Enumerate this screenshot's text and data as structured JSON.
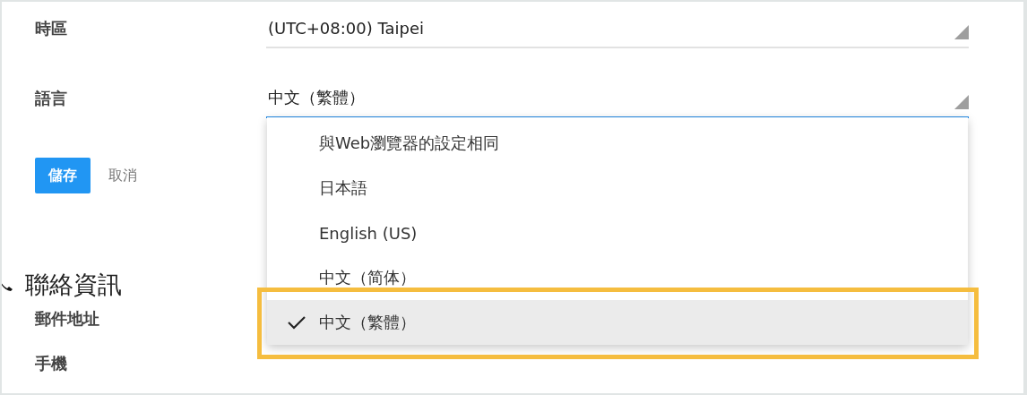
{
  "settings": [
    {
      "label": "時區",
      "value": "(UTC+08:00) Taipei",
      "focused": false
    },
    {
      "label": "語言",
      "value": "中文（繁體）",
      "focused": true
    }
  ],
  "buttons": [
    {
      "label": "儲存",
      "kind": "primary"
    },
    {
      "label": "取消",
      "kind": "text"
    }
  ],
  "section": {
    "title": "聯絡資訊"
  },
  "contact_fields": [
    {
      "label": "郵件地址"
    },
    {
      "label": "手機"
    }
  ],
  "dropdown": {
    "options": [
      {
        "label": "與Web瀏覽器的設定相同",
        "selected": false,
        "highlighted": false
      },
      {
        "label": "日本語",
        "selected": false,
        "highlighted": false
      },
      {
        "label": "English (US)",
        "selected": false,
        "highlighted": false
      },
      {
        "label": "中文（简体）",
        "selected": false,
        "highlighted": false
      },
      {
        "label": "中文（繁體）",
        "selected": true,
        "highlighted": true
      }
    ]
  }
}
